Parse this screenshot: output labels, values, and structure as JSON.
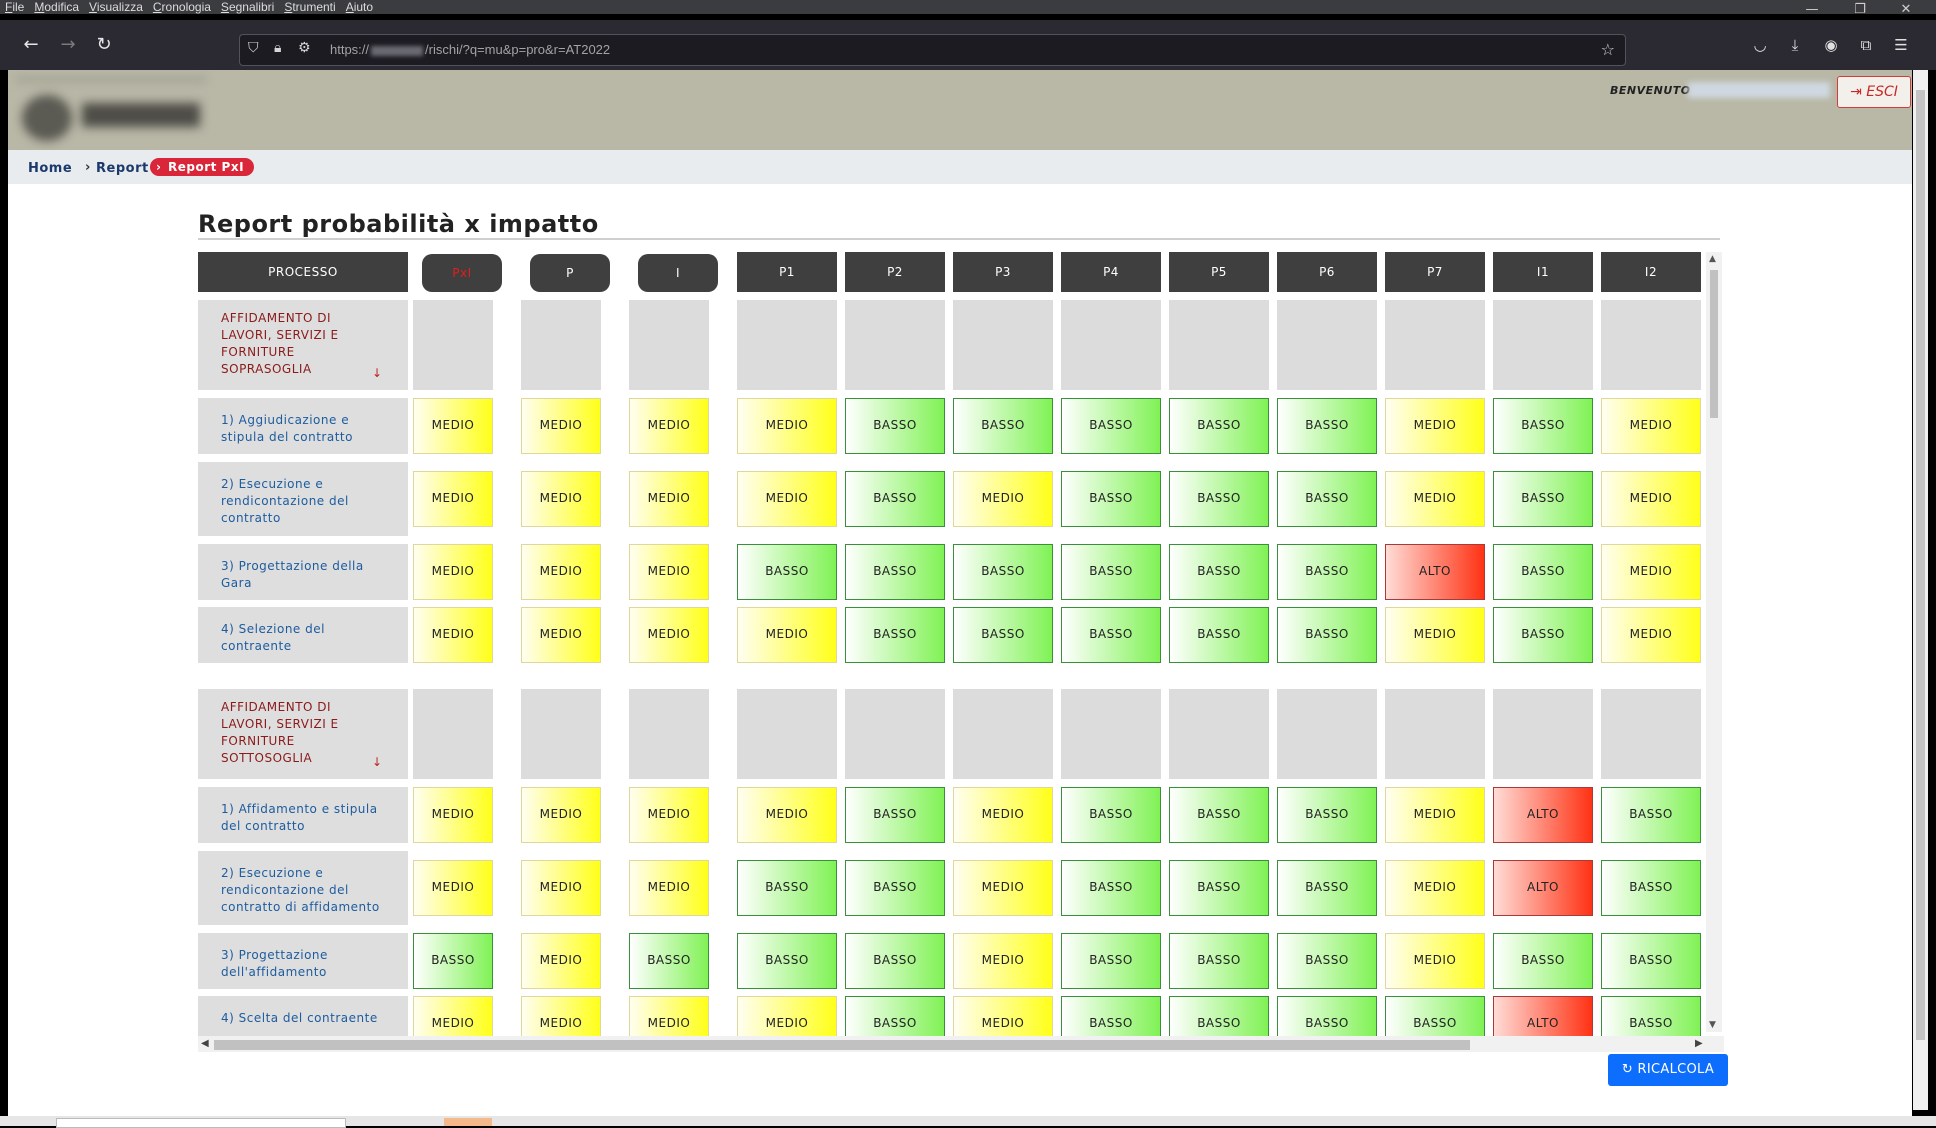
{
  "menubar": [
    "File",
    "Modifica",
    "Visualizza",
    "Cronologia",
    "Segnalibri",
    "Strumenti",
    "Aiuto"
  ],
  "browser": {
    "url_prefix": "https://",
    "url_suffix": "/rischi/?q=mu&p=pro&r=AT2022"
  },
  "header": {
    "welcome_label": "BENVENUTO",
    "logout_label": "ESCI"
  },
  "breadcrumb": {
    "home": "Home",
    "report": "Report",
    "active": "Report PxI"
  },
  "page_title": "Report probabilità x impatto",
  "table": {
    "columns": [
      "PROCESSO",
      "PxI",
      "P",
      "I",
      "P1",
      "P2",
      "P3",
      "P4",
      "P5",
      "P6",
      "P7",
      "I1",
      "I2"
    ],
    "rows": [
      {
        "type": "group",
        "label": "AFFIDAMENTO DI LAVORI, SERVIZI E FORNITURE SOPRASOGLIA",
        "values": []
      },
      {
        "type": "sub",
        "label": "1) Aggiudicazione e stipula del contratto",
        "values": [
          "MEDIO",
          "MEDIO",
          "MEDIO",
          "MEDIO",
          "BASSO",
          "BASSO",
          "BASSO",
          "BASSO",
          "BASSO",
          "MEDIO",
          "BASSO",
          "MEDIO"
        ]
      },
      {
        "type": "sub",
        "label": "2) Esecuzione e rendicontazione del contratto",
        "values": [
          "MEDIO",
          "MEDIO",
          "MEDIO",
          "MEDIO",
          "BASSO",
          "MEDIO",
          "BASSO",
          "BASSO",
          "BASSO",
          "MEDIO",
          "BASSO",
          "MEDIO"
        ]
      },
      {
        "type": "sub",
        "label": "3) Progettazione della Gara",
        "values": [
          "MEDIO",
          "MEDIO",
          "MEDIO",
          "BASSO",
          "BASSO",
          "BASSO",
          "BASSO",
          "BASSO",
          "BASSO",
          "ALTO",
          "BASSO",
          "MEDIO"
        ]
      },
      {
        "type": "sub",
        "label": "4) Selezione del contraente",
        "values": [
          "MEDIO",
          "MEDIO",
          "MEDIO",
          "MEDIO",
          "BASSO",
          "BASSO",
          "BASSO",
          "BASSO",
          "BASSO",
          "MEDIO",
          "BASSO",
          "MEDIO"
        ]
      },
      {
        "type": "group",
        "label": "AFFIDAMENTO DI LAVORI, SERVIZI E FORNITURE SOTTOSOGLIA",
        "values": []
      },
      {
        "type": "sub",
        "label": "1) Affidamento e stipula del contratto",
        "values": [
          "MEDIO",
          "MEDIO",
          "MEDIO",
          "MEDIO",
          "BASSO",
          "MEDIO",
          "BASSO",
          "BASSO",
          "BASSO",
          "MEDIO",
          "ALTO",
          "BASSO"
        ]
      },
      {
        "type": "sub",
        "label": "2) Esecuzione e rendicontazione del contratto di affidamento",
        "values": [
          "MEDIO",
          "MEDIO",
          "MEDIO",
          "BASSO",
          "BASSO",
          "MEDIO",
          "BASSO",
          "BASSO",
          "BASSO",
          "MEDIO",
          "ALTO",
          "BASSO"
        ]
      },
      {
        "type": "sub",
        "label": "3) Progettazione dell'affidamento",
        "values": [
          "BASSO",
          "MEDIO",
          "BASSO",
          "BASSO",
          "BASSO",
          "MEDIO",
          "BASSO",
          "BASSO",
          "BASSO",
          "MEDIO",
          "BASSO",
          "BASSO"
        ]
      },
      {
        "type": "sub",
        "label": "4) Scelta del contraente",
        "values": [
          "MEDIO",
          "MEDIO",
          "MEDIO",
          "MEDIO",
          "BASSO",
          "MEDIO",
          "BASSO",
          "BASSO",
          "BASSO",
          "BASSO",
          "ALTO",
          "BASSO"
        ]
      }
    ]
  },
  "recalc_label": "RICALCOLA",
  "colors": {
    "medio": "#ffff1a",
    "basso": "#80f255",
    "alto": "#ff3214",
    "header_bg": "#3f3f3f",
    "breadcrumb_active": "#d92638",
    "primary_button": "#0d6efd"
  }
}
